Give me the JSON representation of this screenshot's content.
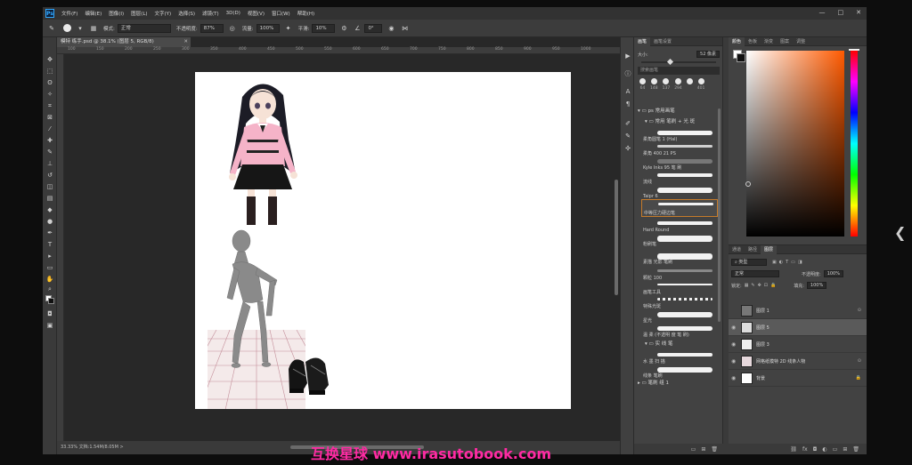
{
  "menu": {
    "items": [
      "文件(F)",
      "编辑(E)",
      "图像(I)",
      "图层(L)",
      "文字(Y)",
      "选择(S)",
      "滤镜(T)",
      "3D(D)",
      "视图(V)",
      "窗口(W)",
      "帮助(H)"
    ],
    "win_controls": [
      "—",
      "□",
      "✕"
    ]
  },
  "options": {
    "mode_label": "模式:",
    "mode_value": "正常",
    "opacity_label": "不透明度:",
    "opacity_value": "87%",
    "flow_label": "流量:",
    "flow_value": "100%",
    "smooth_label": "平滑:",
    "smooth_value": "10%",
    "angle_value": "0°"
  },
  "document": {
    "tab_title": "模特 练手.psd @ 38.1% (图层 5, RGB/8)",
    "close_symbol": "✕",
    "ruler_ticks": [
      "100",
      "150",
      "200",
      "250",
      "300",
      "350",
      "400",
      "450",
      "500",
      "550",
      "600",
      "650",
      "700",
      "750",
      "800",
      "850",
      "900",
      "950",
      "1000"
    ],
    "status": "33.33%   文档:1.54M/8.05M   >"
  },
  "brush_panel": {
    "tabs": [
      "画笔",
      "画笔设置"
    ],
    "size_label": "大小:",
    "size_value": "52 像素",
    "search_placeholder": "搜索画笔",
    "presets": [
      "64",
      "148",
      "137",
      "294",
      "",
      "401"
    ],
    "group_main": "ps 常用画笔",
    "group_sub": "常用 笔刷 + 光 斑",
    "items": [
      "柔角圆笔 1 (Hal)",
      "柔角 400 21 PS",
      "Kyle Inks 95 笔 刷",
      "流线",
      "Taipr 6",
      "中等压力硬边笔",
      "Hard Round",
      "粉刷笔",
      "素描 光影 笔刷",
      "颗粒 100",
      "画笔工具",
      "特殊光斑",
      "星光",
      "温 柔 (不透明 度 笔 刷)",
      "实 线 笔",
      "水 墨 扫 描",
      "线条 笔刷"
    ],
    "group_bottom": "笔刷 组 1"
  },
  "color_panel": {
    "tabs": [
      "颜色",
      "色板",
      "渐变",
      "图案",
      "调整"
    ]
  },
  "layers_panel": {
    "tabs": [
      "图层",
      "通道",
      "路径"
    ],
    "filter_value": "类型",
    "blend_value": "正常",
    "opacity_label": "不透明度:",
    "opacity_value": "100%",
    "lock_label": "锁定:",
    "fill_label": "填充:",
    "fill_value": "100%",
    "layers": [
      {
        "name": "图层 1",
        "selected": false
      },
      {
        "name": "图层 5",
        "selected": true
      },
      {
        "name": "图层 3",
        "selected": false
      },
      {
        "name": "网格纸模特 2D 线条人物",
        "selected": false
      },
      {
        "name": "背景",
        "selected": false
      }
    ]
  },
  "watermark": "互换星球 www.irasutobook.com",
  "colors": {
    "watermark": "#ff2aa3",
    "selection_outline": "#c57a2a",
    "accent_hue": "#ff5a00"
  }
}
